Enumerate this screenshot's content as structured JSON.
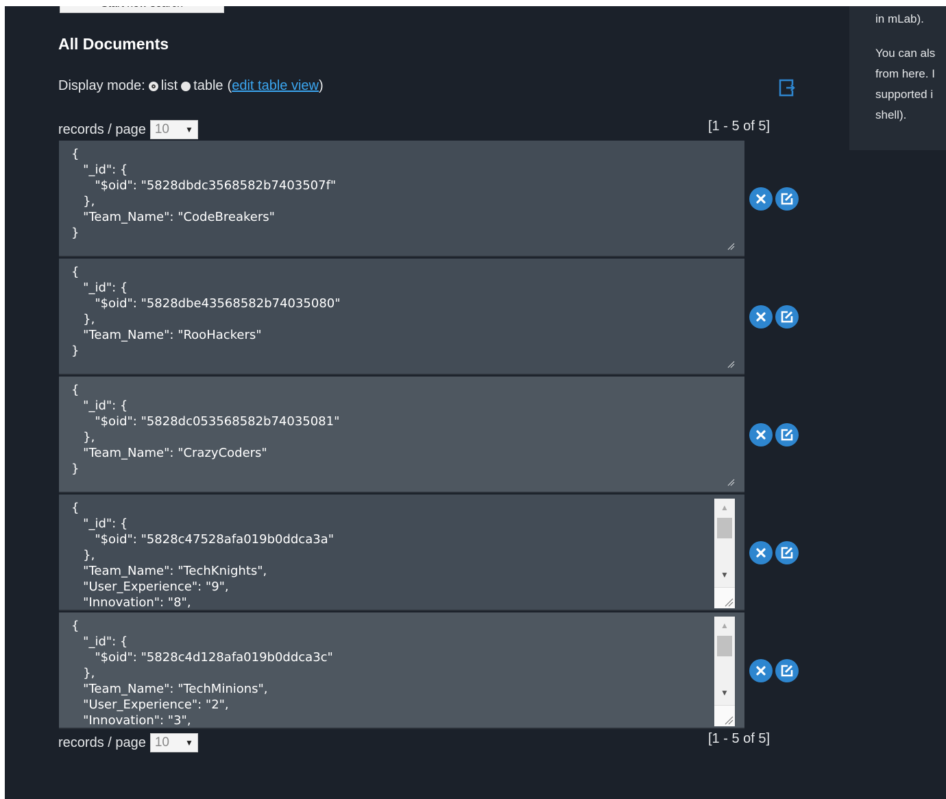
{
  "top_button": {
    "label": "Start new search"
  },
  "side_panel": {
    "line1": "in mLab).",
    "para2_lines": [
      "You can als",
      "from here. I",
      "supported i",
      "shell)."
    ]
  },
  "heading": "All Documents",
  "display_mode": {
    "label": "Display mode:",
    "options": [
      "list",
      "table"
    ],
    "selected": "list",
    "open_paren": "(",
    "edit_link": "edit table view",
    "close_paren": ")"
  },
  "pagination": {
    "records_label": "records / page",
    "per_page": "10",
    "range": "[1 - 5 of 5]"
  },
  "documents": [
    {
      "text": "{\n   \"_id\": {\n      \"$oid\": \"5828dbdc3568582b7403507f\"\n   },\n   \"Team_Name\": \"CodeBreakers\"\n}"
    },
    {
      "text": "{\n   \"_id\": {\n      \"$oid\": \"5828dbe43568582b74035080\"\n   },\n   \"Team_Name\": \"RooHackers\"\n}"
    },
    {
      "text": "{\n   \"_id\": {\n      \"$oid\": \"5828dc053568582b74035081\"\n   },\n   \"Team_Name\": \"CrazyCoders\"\n}"
    },
    {
      "text": "{\n   \"_id\": {\n      \"$oid\": \"5828c47528afa019b0ddca3a\"\n   },\n   \"Team_Name\": \"TechKnights\",\n   \"User_Experience\": \"9\",\n   \"Innovation\": \"8\","
    },
    {
      "text": "{\n   \"_id\": {\n      \"$oid\": \"5828c4d128afa019b0ddca3c\"\n   },\n   \"Team_Name\": \"TechMinions\",\n   \"User_Experience\": \"2\",\n   \"Innovation\": \"3\","
    }
  ],
  "colors": {
    "accent": "#2e86cf",
    "link": "#3ba6f0",
    "background": "#1b212a"
  }
}
